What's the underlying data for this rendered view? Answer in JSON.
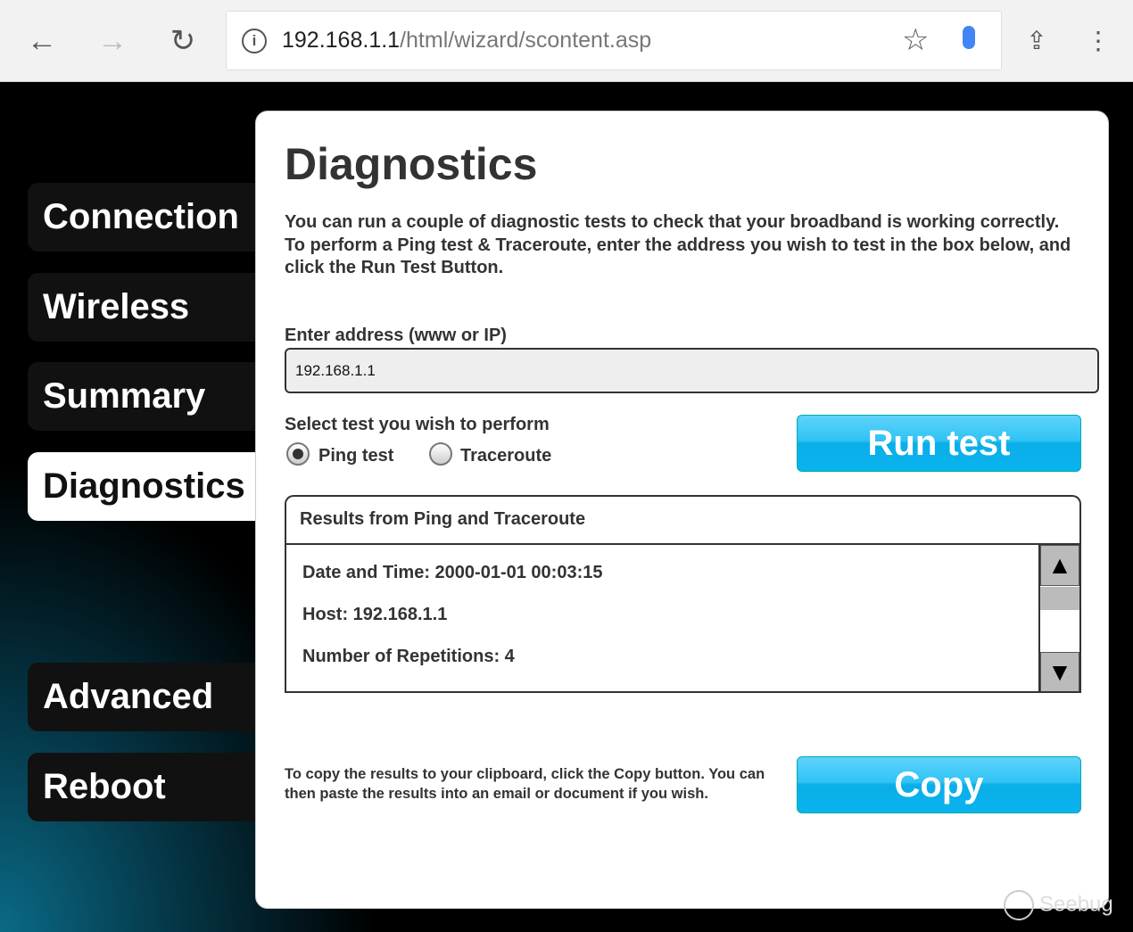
{
  "browser": {
    "url_host": "192.168.1.1",
    "url_path": "/html/wizard/scontent.asp"
  },
  "sidebar": {
    "items": [
      {
        "label": "Connection"
      },
      {
        "label": "Wireless"
      },
      {
        "label": "Summary"
      },
      {
        "label": "Diagnostics",
        "active": true
      },
      {
        "label": "Advanced"
      },
      {
        "label": "Reboot"
      }
    ]
  },
  "main": {
    "title": "Diagnostics",
    "description_1": "You can run a couple of diagnostic tests to check that your broadband is working correctly.",
    "description_2": "To perform a Ping test & Traceroute, enter the address you wish to test in the box below, and click the Run Test Button.",
    "address_label": "Enter address (www or IP)",
    "address_value": "192.168.1.1",
    "select_label": "Select test you wish to perform",
    "options": [
      {
        "label": "Ping test",
        "selected": true
      },
      {
        "label": "Traceroute",
        "selected": false
      }
    ],
    "run_button": "Run test",
    "results_title": "Results from Ping and Traceroute",
    "results_lines": [
      "Date and Time: 2000-01-01 00:03:15",
      "Host: 192.168.1.1",
      "Number of Repetitions: 4"
    ],
    "copy_text": "To copy the results to your clipboard, click the Copy button. You can then paste the results into an email or document if you wish.",
    "copy_button": "Copy"
  },
  "watermark": "Seebug",
  "colors": {
    "accent": "#1ab8f0"
  }
}
